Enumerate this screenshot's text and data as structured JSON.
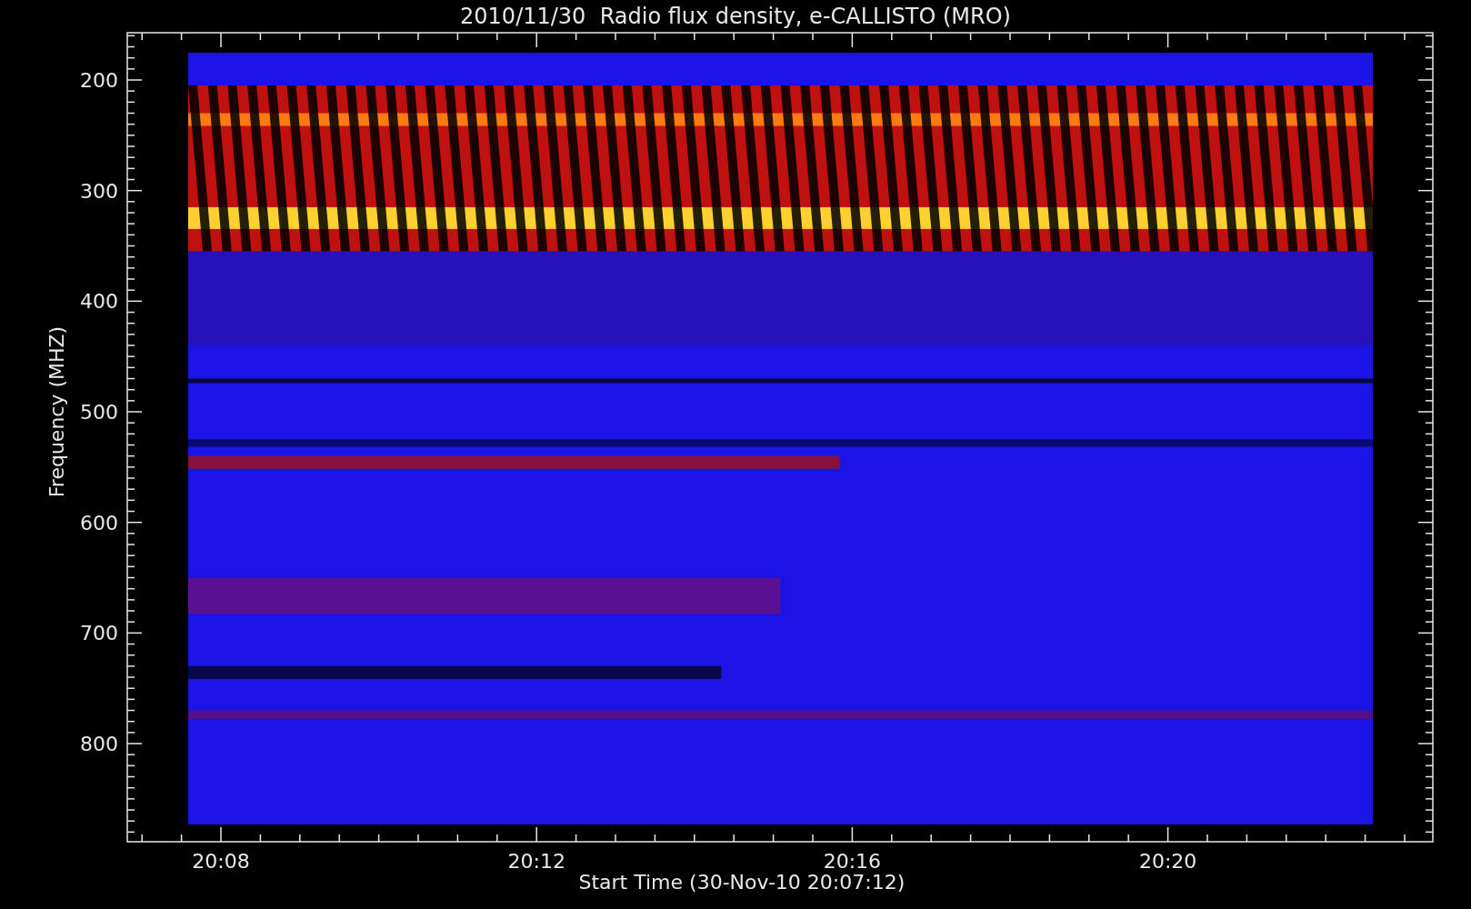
{
  "title": "2010/11/30  Radio flux density, e-CALLISTO (MRO)",
  "y_axis": {
    "label": "Frequency (MHZ)",
    "ticks": [
      "200",
      "300",
      "400",
      "500",
      "600",
      "700",
      "800"
    ]
  },
  "x_axis": {
    "label": "Start Time (30-Nov-10 20:07:12)",
    "ticks": [
      "20:08",
      "20:12",
      "20:16",
      "20:20"
    ]
  }
}
